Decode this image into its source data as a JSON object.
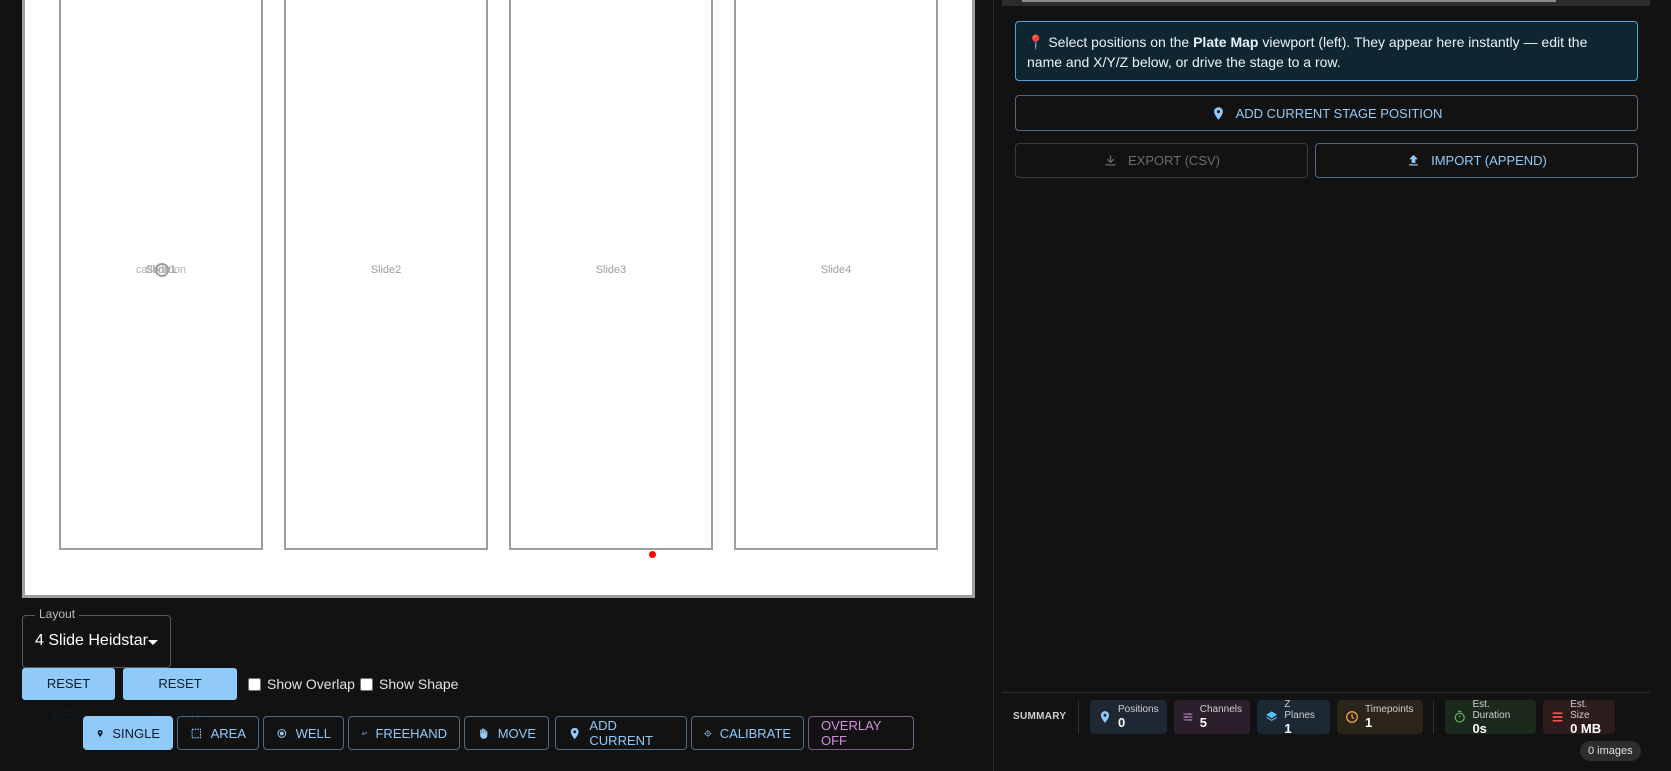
{
  "plate": {
    "slides": [
      {
        "label": "Slide1",
        "overlay_label": "calibration"
      },
      {
        "label": "Slide2"
      },
      {
        "label": "Slide3"
      },
      {
        "label": "Slide4"
      }
    ]
  },
  "layout": {
    "legend": "Layout",
    "selected": "4 Slide Heidstar"
  },
  "controls": {
    "reset_view": "RESET VIEW",
    "reset_history": "RESET HISTORY",
    "show_overlap": "Show Overlap",
    "show_shape": "Show Shape"
  },
  "toolbar": {
    "single": "SINGLE",
    "area": "AREA",
    "well": "WELL",
    "freehand": "FREEHAND",
    "move": "MOVE",
    "add_current": "ADD CURRENT",
    "calibrate": "CALIBRATE",
    "overlay": "OVERLAY OFF"
  },
  "right_panel": {
    "info_pre": "Select positions on the ",
    "info_bold": "Plate Map",
    "info_post": " viewport (left). They appear here instantly — edit the name and X/Y/Z below, or drive the stage to a row.",
    "add_current_stage": "ADD CURRENT STAGE POSITION",
    "export": "EXPORT (CSV)",
    "import": "IMPORT (APPEND)"
  },
  "summary": {
    "title": "SUMMARY",
    "positions": {
      "label": "Positions",
      "value": "0"
    },
    "channels": {
      "label": "Channels",
      "value": "5"
    },
    "z_planes": {
      "label": "Z Planes",
      "value": "1"
    },
    "timepoints": {
      "label": "Timepoints",
      "value": "1"
    },
    "est_duration": {
      "label": "Est. Duration",
      "value": "0s"
    },
    "est_size": {
      "label": "Est. Size",
      "value": "0 MB"
    },
    "images_badge": "0 images"
  },
  "colors": {
    "accent": "#90caf9",
    "overlay": "#ce93d8",
    "stage_dot": "#ff0000"
  }
}
